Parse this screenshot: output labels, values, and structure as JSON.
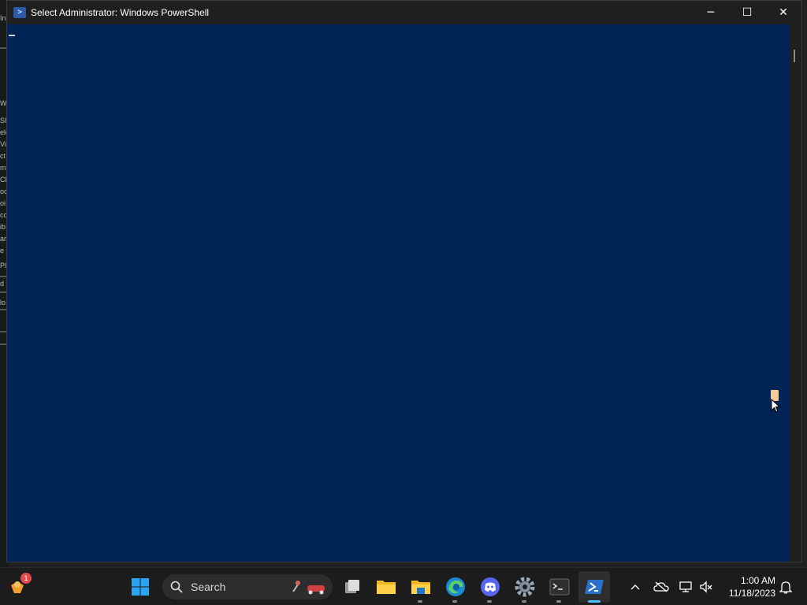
{
  "window": {
    "title": "Select Administrator: Windows PowerShell",
    "controls": {
      "minimize": "─",
      "maximize": "☐",
      "close": "✕"
    }
  },
  "console": {
    "background": "#012456",
    "text": ""
  },
  "background_window": {
    "sliver_texts": [
      "In",
      "W",
      "Sh",
      "ele",
      "Vi",
      "ct",
      "m",
      "Cl",
      "oc",
      "oi",
      "co",
      "ib",
      "ar",
      "e",
      "Pl",
      "d",
      "lo"
    ]
  },
  "taskbar": {
    "search_label": "Search",
    "widget_badge": "1",
    "clock": {
      "time": "1:00 AM",
      "date": "11/18/2023"
    },
    "icons": [
      "widgets-icon",
      "windows-start-icon",
      "search-icon",
      "task-view-icon",
      "file-explorer-icon",
      "file-explorer-icon",
      "edge-icon",
      "discord-icon",
      "settings-icon",
      "terminal-icon",
      "powershell-icon"
    ],
    "tray": [
      "chevron-up-icon",
      "onedrive-icon",
      "network-icon",
      "volume-muted-icon",
      "notifications-bell-icon"
    ]
  },
  "colors": {
    "accent": "#4cc2ff",
    "taskbar": "#1c1c1c",
    "titlebar": "#1f1f1f"
  }
}
